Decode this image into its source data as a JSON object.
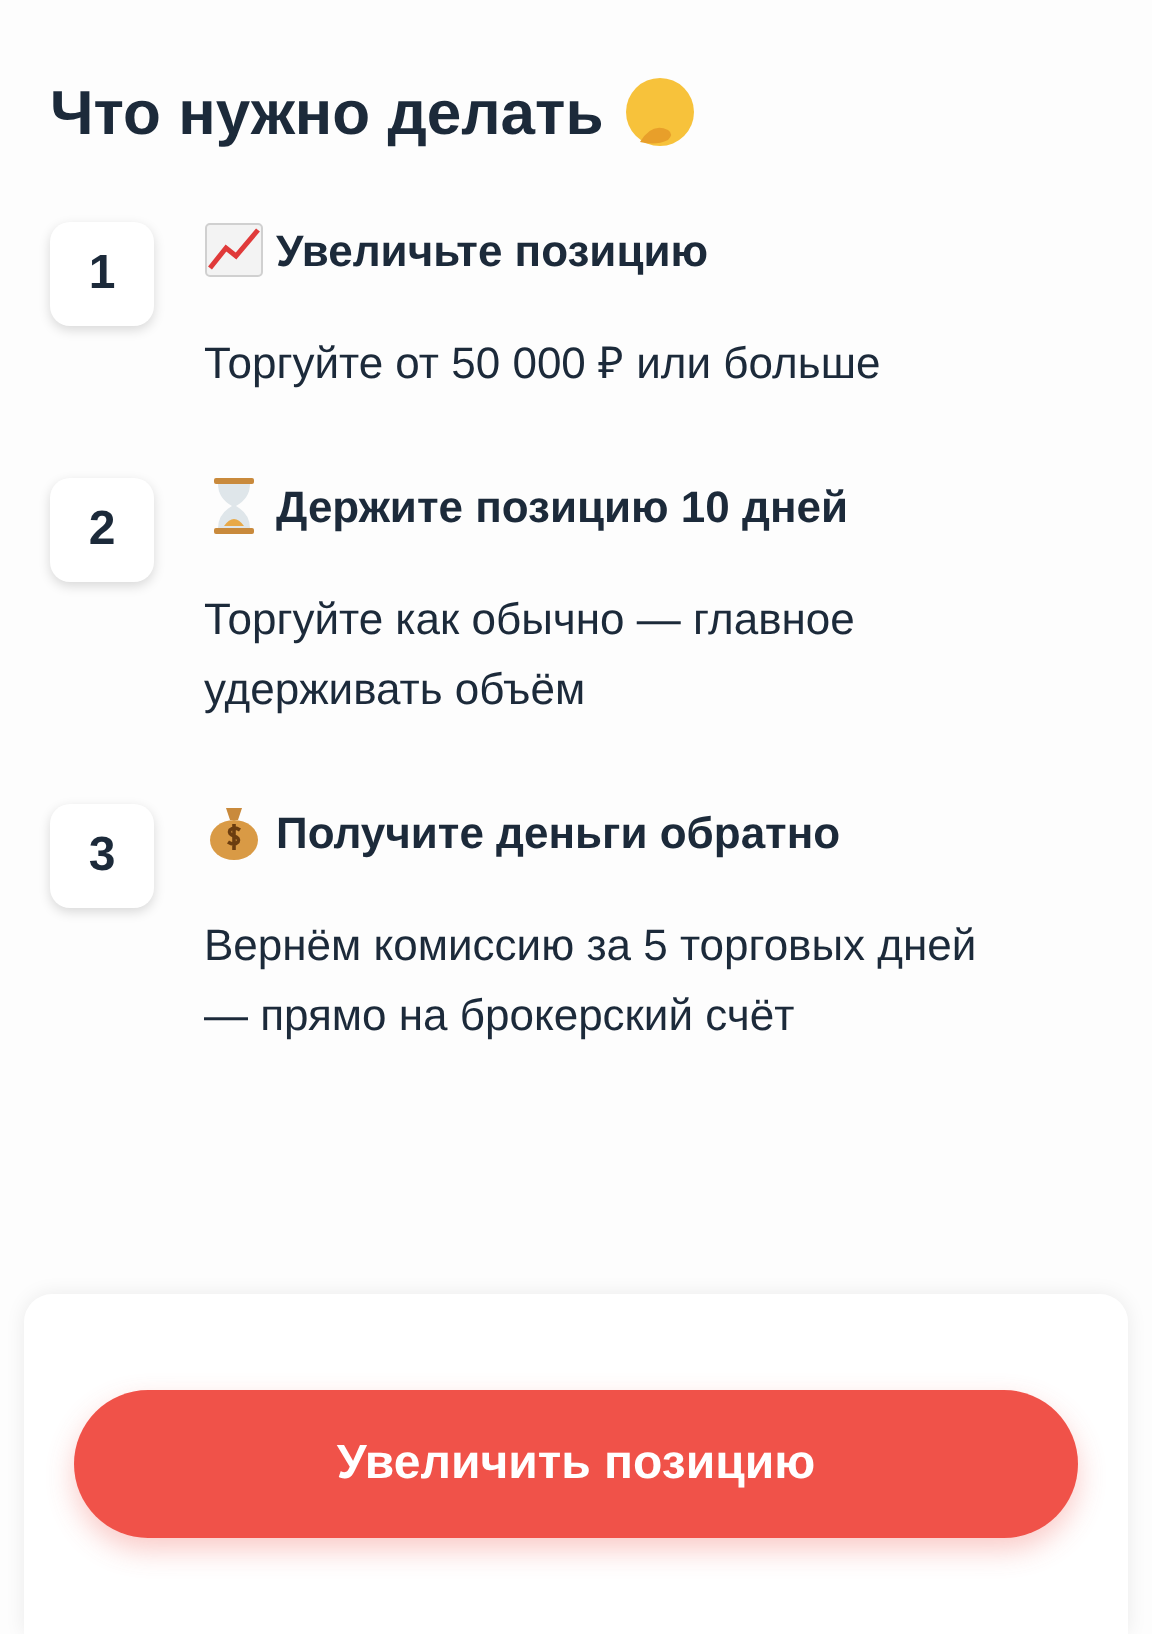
{
  "title": "Что нужно делать",
  "steps": [
    {
      "number": "1",
      "heading": "Увеличьте позицию",
      "text": "Торгуйте от 50 000 ₽ или больше"
    },
    {
      "number": "2",
      "heading": "Держите позицию 10 дней",
      "text": "Торгуйте как обычно — главное удерживать объём"
    },
    {
      "number": "3",
      "heading": "Получите деньги обратно",
      "text": "Вернём комиссию за 5 торговых дней — прямо на брокерский счёт"
    }
  ],
  "button": {
    "label": "Увеличить позицию"
  }
}
